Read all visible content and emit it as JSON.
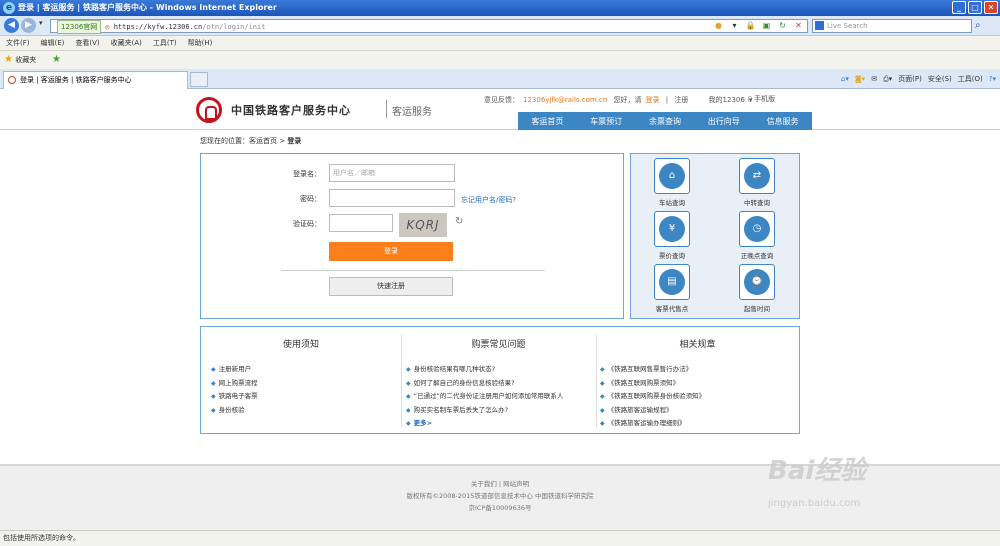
{
  "window": {
    "title": "登录 | 客运服务 | 铁路客户服务中心 - Windows Internet Explorer"
  },
  "browser": {
    "site_badge": "12306官网",
    "url_prefix": "https://",
    "url": "kyfw.12306.cn",
    "url_path": "/otn/login/init",
    "search_placeholder": "Live Search",
    "menu": [
      "文件(F)",
      "编辑(E)",
      "查看(V)",
      "收藏夹(A)",
      "工具(T)",
      "帮助(H)"
    ],
    "favorites_label": "收藏夹",
    "tab_title": "登录 | 客运服务 | 铁路客户服务中心",
    "commands": [
      "页面(P)",
      "安全(S)",
      "工具(O)"
    ]
  },
  "header": {
    "brand": "中国铁路客户服务中心",
    "sub": "客运服务",
    "feedback_label": "意见反馈：",
    "feedback_email": "12306yjfk@rails.com.cn",
    "greeting": "您好，请",
    "login": "登录",
    "separator": "|",
    "register": "注册",
    "my12306": "我的12306",
    "mobile": "手机版"
  },
  "nav": [
    "客运首页",
    "车票预订",
    "余票查询",
    "出行向导",
    "信息服务"
  ],
  "breadcrumb": {
    "prefix": "您现在的位置：",
    "home": "客运首页",
    "sep": ">",
    "current": "登录"
  },
  "login": {
    "username_label": "登录名：",
    "username_placeholder": "用户名／邮箱",
    "password_label": "密码：",
    "forgot": "忘记用户名/密码?",
    "captcha_label": "验证码：",
    "captcha_text": "KQRJ",
    "submit": "登录",
    "quick_register": "快速注册"
  },
  "services": [
    {
      "label": "车站查询",
      "icon": "station-icon"
    },
    {
      "label": "中转查询",
      "icon": "transfer-icon"
    },
    {
      "label": "票价查询",
      "icon": "fare-icon"
    },
    {
      "label": "正晚点查询",
      "icon": "clock-icon"
    },
    {
      "label": "客票代售点",
      "icon": "ticket-agency-icon"
    },
    {
      "label": "起售时间",
      "icon": "sale-time-icon"
    }
  ],
  "info": {
    "notice": {
      "title": "使用须知",
      "items": [
        "注册新用户",
        "网上购票流程",
        "铁路电子客票",
        "身份核验"
      ]
    },
    "faq": {
      "title": "购票常见问题",
      "items": [
        "身份核验结果有哪几种状态?",
        "如何了解自己的身份信息核验结果?",
        "“已通过”的二代身份证注册用户如何添加常用联系人",
        "购买实名制车票后丢失了怎么办?"
      ],
      "more": "更多>"
    },
    "rules": {
      "title": "相关规章",
      "items": [
        "《铁路互联网售票暂行办法》",
        "《铁路互联网购票须知》",
        "《铁路互联网购票身份核验须知》",
        "《铁路旅客运输规程》",
        "《铁路旅客运输办理细则》"
      ]
    }
  },
  "footer": {
    "links": "关于我们 | 网站声明",
    "copyright": "版权所有©2008-2015铁道部信息技术中心  中国铁道科学研究院",
    "icp": "京ICP备10009636号"
  },
  "watermark": {
    "main": "Bai经验",
    "sub": "jingyan.baidu.com"
  },
  "status": "包括使用所选项的命令。"
}
